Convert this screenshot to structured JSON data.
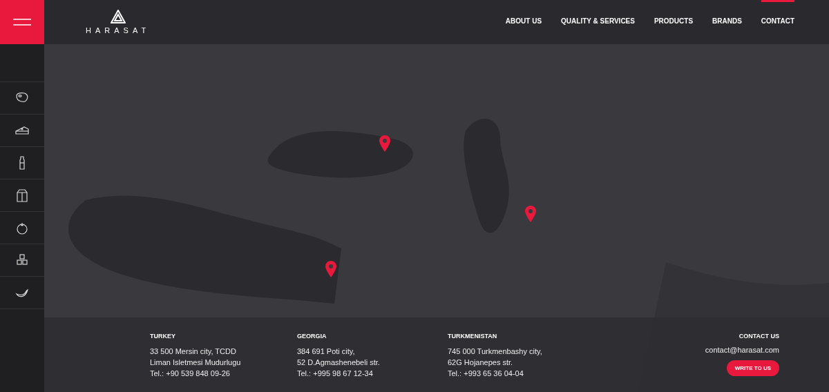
{
  "header": {
    "logo": "HARASAT",
    "nav": [
      {
        "label": "ABOUT US",
        "selected": false
      },
      {
        "label": "QUALITY & SERVICES",
        "selected": false
      },
      {
        "label": "PRODUCTS",
        "selected": false
      },
      {
        "label": "BRANDS",
        "selected": false
      },
      {
        "label": "CONTACT",
        "selected": true
      }
    ]
  },
  "sidebar": {
    "items": [
      {
        "kind": "meat"
      },
      {
        "kind": "cheese"
      },
      {
        "kind": "bottle"
      },
      {
        "kind": "carton"
      },
      {
        "kind": "tomato"
      },
      {
        "kind": "cubes"
      },
      {
        "kind": "banana"
      }
    ]
  },
  "offices": [
    {
      "country": "TURKEY",
      "lines": [
        "33 500 Mersin city, TCDD",
        "Liman Isletmesi Mudurlugu",
        "Tel.: +90 539 848 09-26"
      ]
    },
    {
      "country": "GEORGIA",
      "lines": [
        "384 691 Poti city,",
        "52 D.Agmashenebeli str.",
        "Tel.: +995 98 67 12-34"
      ]
    },
    {
      "country": "TURKMENISTAN",
      "lines": [
        "745 000 Turkmenbashy city,",
        "62G Hojanepes str.",
        "Tel.: +993 65 36 04-04"
      ]
    }
  ],
  "contact": {
    "title": "CONTACT US",
    "email": "contact@harasat.com",
    "button": "WRITE TO US"
  }
}
